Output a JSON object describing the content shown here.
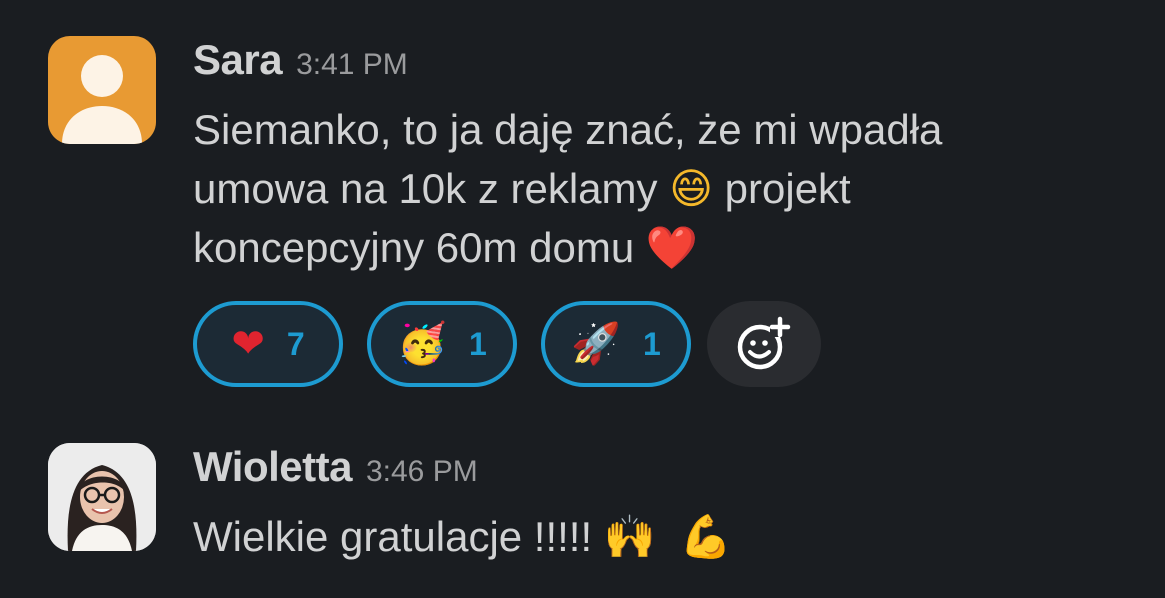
{
  "messages": [
    {
      "author": "Sara",
      "time": "3:41 PM",
      "text_line1": "Siemanko, to ja daję znać, że mi wpadła",
      "text_line2a": "umowa na 10k z reklamy ",
      "text_line2_emoji": "😄",
      "text_line2b": " projekt",
      "text_line3a": "koncepcyjny 60m domu ",
      "text_line3_emoji": "❤️",
      "reactions": [
        {
          "emoji": "❤",
          "count": "7"
        },
        {
          "emoji": "🥳",
          "count": "1"
        },
        {
          "emoji": "🚀",
          "count": "1"
        }
      ]
    },
    {
      "author": "Wioletta",
      "time": "3:46 PM",
      "text": "Wielkie gratulacje !!!!! ",
      "emoji1": "🙌",
      "emoji2": "💪"
    }
  ],
  "icons": {
    "avatar_sara": "person-silhouette-icon",
    "avatar_wioletta": "profile-photo",
    "add_reaction": "add-emoji-icon"
  },
  "colors": {
    "background": "#1a1d21",
    "text": "#d1d2d3",
    "accent": "#1d9bd1",
    "sara_avatar": "#e89a33"
  }
}
